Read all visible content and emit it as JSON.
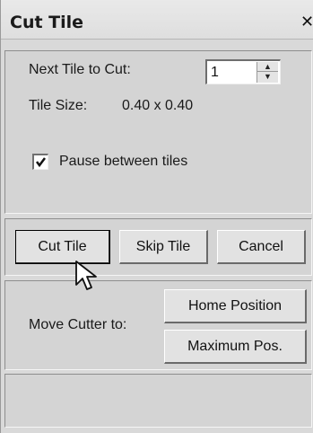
{
  "window": {
    "title": "Cut Tile",
    "close_glyph": "✕"
  },
  "tile_settings": {
    "next_tile_label": "Next Tile to Cut:",
    "next_tile_value": "1",
    "tile_size_label": "Tile Size:",
    "tile_size_value": "0.40 x 0.40",
    "pause_label": "Pause between tiles",
    "pause_checked": true
  },
  "actions": {
    "cut_tile_label": "Cut Tile",
    "skip_tile_label": "Skip Tile",
    "cancel_label": "Cancel"
  },
  "move_cutter": {
    "label": "Move Cutter to:",
    "home_label": "Home Position",
    "max_label": "Maximum Pos."
  },
  "icons": {
    "close": "close-icon",
    "spin_up": "spin-up-arrow-icon",
    "spin_down": "spin-down-arrow-icon",
    "checkmark": "checkmark-icon",
    "cursor": "mouse-pointer-icon"
  },
  "colors": {
    "window_bg": "#d9d9d9",
    "panel_bg": "#d4d4d4",
    "button_bg": "#e2e2e2"
  }
}
